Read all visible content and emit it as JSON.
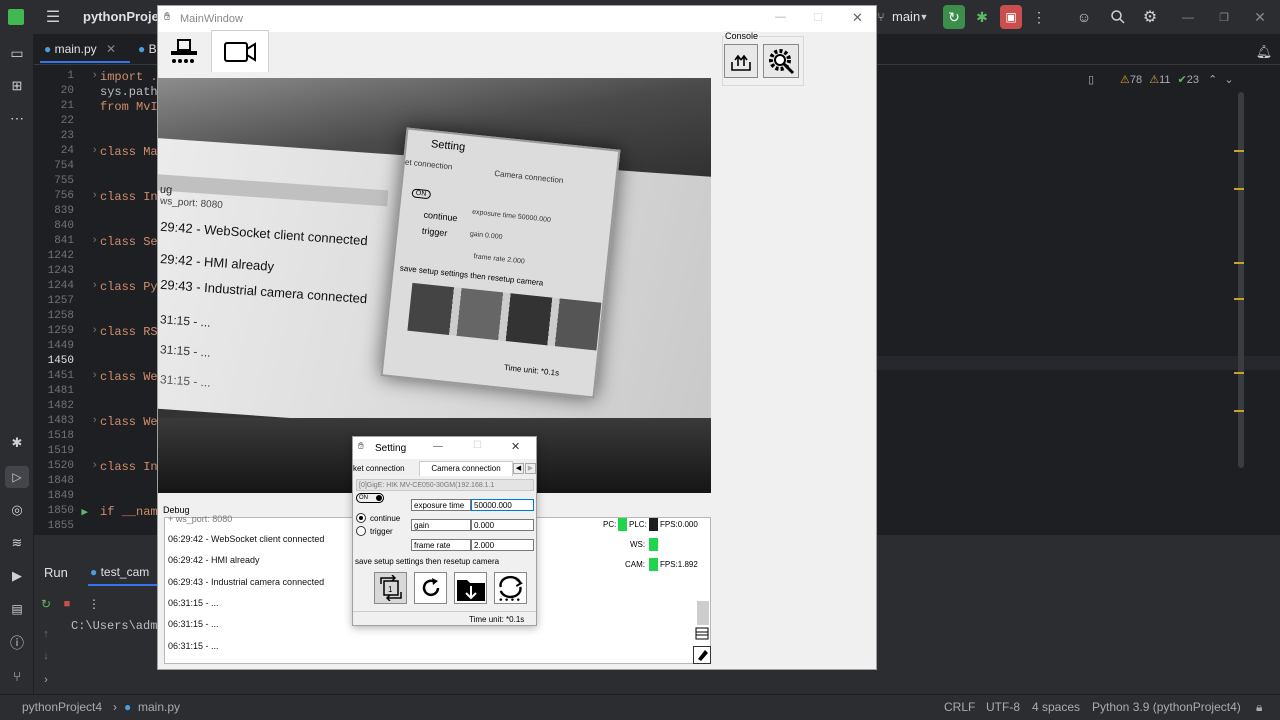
{
  "ide": {
    "project": "pythonProject",
    "branch": "main",
    "editor_tabs": [
      "main.py",
      "B"
    ],
    "line_numbers": [
      "1",
      "20",
      "21",
      "22",
      "23",
      "24",
      "754",
      "755",
      "756",
      "839",
      "840",
      "841",
      "1242",
      "1243",
      "1244",
      "1257",
      "1258",
      "1259",
      "1449",
      "1450",
      "1451",
      "1481",
      "1482",
      "1483",
      "1518",
      "1519",
      "1520",
      "1848",
      "1849",
      "1850",
      "1855"
    ],
    "code_lines": [
      "import .",
      "sys.path",
      "from MvIm",
      "",
      "",
      "class Ma",
      "",
      "",
      "class In",
      "",
      "",
      "class Se",
      "",
      "",
      "class Py",
      "",
      "",
      "class RS",
      "",
      "",
      "class We",
      "",
      "",
      "class We",
      "",
      "",
      "class Inc",
      "",
      "",
      "if __nam",
      ""
    ],
    "inspections": {
      "warnings": "78",
      "weak_warnings": "11",
      "ok": "23"
    },
    "run_tabs": [
      "Run",
      "test_cam"
    ],
    "run_output": "C:\\Users\\admi"
  },
  "status": {
    "breadcrumb_project": "pythonProject4",
    "breadcrumb_file": "main.py",
    "line_sep": "CRLF",
    "encoding": "UTF-8",
    "indent": "4 spaces",
    "interpreter": "Python 3.9 (pythonProject4)"
  },
  "mainwindow": {
    "title": "MainWindow",
    "console_label": "Console",
    "debug_label": "Debug",
    "debug_lines": [
      "06:29:42 - WebSocket client connected",
      "06:29:42 - HMI already",
      "06:29:43 - Industrial camera connected",
      "06:31:15 - ...",
      "06:31:15 - ...",
      "06:31:15 - ..."
    ],
    "debug_partial_top": "+ ws_port: 8080",
    "indicators": {
      "pc": "PC:",
      "plc": "PLC:",
      "fps_plc": "FPS:0.000",
      "ws": "WS:",
      "cam": "CAM:",
      "fps_cam": "FPS:1.892"
    }
  },
  "camera_image_text": {
    "log": [
      "29:42 - WebSocket client connected",
      "29:42 - HMI already",
      "29:43 - Industrial camera connected",
      "31:15 - ...",
      "31:15 - ...",
      "31:15 - ..."
    ],
    "dbg": "ug",
    "port": "ws_port: 8080",
    "setting_title": "Setting",
    "tabs": [
      "et connection",
      "Camera connection"
    ],
    "on": "ON",
    "radio1": "continue",
    "radio2": "trigger",
    "f1": "exposure time",
    "v1": "50000.000",
    "f2": "gain",
    "v2": "0.000",
    "f3": "frame rate",
    "v3": "2.000",
    "save": "save setup settings then resetup camera",
    "time": "Time unit: *0.1s"
  },
  "setting": {
    "title": "Setting",
    "tab_left": "ket connection",
    "tab_right": "Camera connection",
    "device": "[0]GigE: HIK MV-CE050-30GM(192.168.1.1",
    "toggle": "ON",
    "radio_continue": "continue",
    "radio_trigger": "trigger",
    "exposure_label": "exposure time",
    "exposure_value": "50000.000",
    "gain_label": "gain",
    "gain_value": "0.000",
    "framerate_label": "frame rate",
    "framerate_value": "2.000",
    "save_text": "save setup settings then resetup camera",
    "time_unit": "Time unit: *0.1s"
  }
}
